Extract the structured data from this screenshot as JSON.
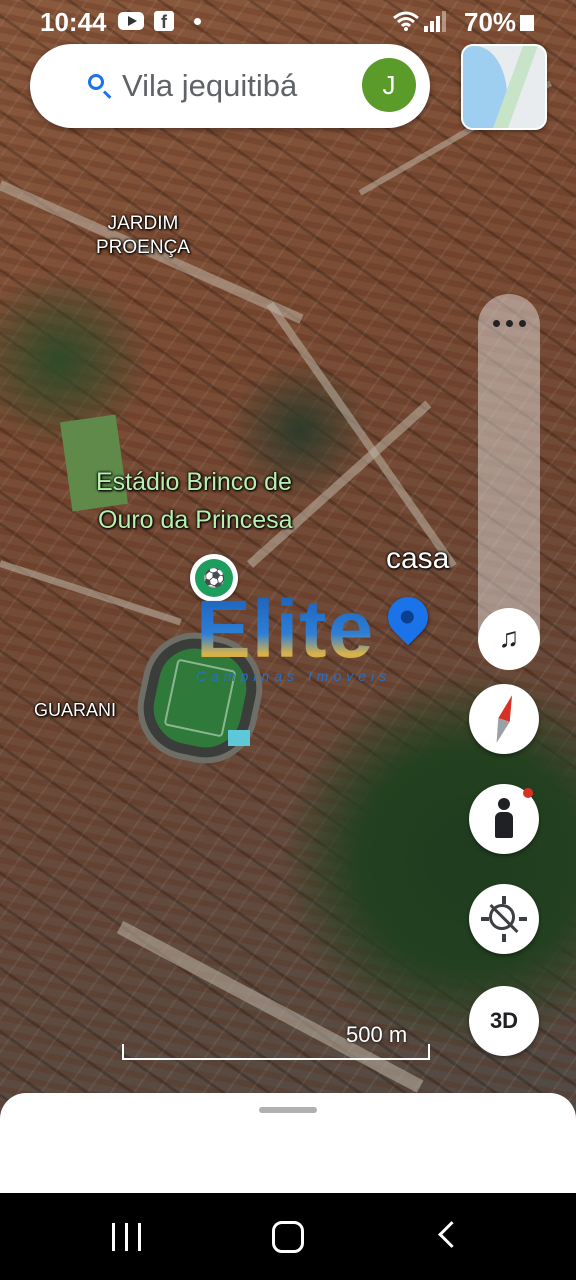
{
  "status_bar": {
    "time": "10:44",
    "battery": "70%",
    "notification_icons": [
      "youtube-icon",
      "facebook-icon",
      "dot-icon"
    ],
    "system_icons": [
      "wifi-icon",
      "signal-icon",
      "battery-icon"
    ]
  },
  "search": {
    "query": "Vila jequitibá",
    "avatar_initial": "J",
    "avatar_color": "#5a9b2a",
    "accent_color": "#1a73e8"
  },
  "map": {
    "view": "satellite",
    "labels": {
      "neighborhood_1": "JARDIM\nPROENÇA",
      "neighborhood_2": "GUARANI",
      "place_line1": "Estádio Brinco de",
      "place_line2": "Ouro da Princesa",
      "saved_pin": "casa"
    },
    "watermark": {
      "brand": "Elite",
      "tagline": "Campinas Imoveis"
    },
    "scale_label": "500 m"
  },
  "controls": {
    "more_icon": "more-horizontal-icon",
    "music_icon": "music-note-icon",
    "compass_icon": "compass-icon",
    "street_view_icon": "pegman-icon",
    "location_icon": "location-off-icon",
    "three_d_label": "3D"
  },
  "navigation_bar": {
    "buttons": [
      "recent-apps-icon",
      "home-icon",
      "back-icon"
    ]
  }
}
